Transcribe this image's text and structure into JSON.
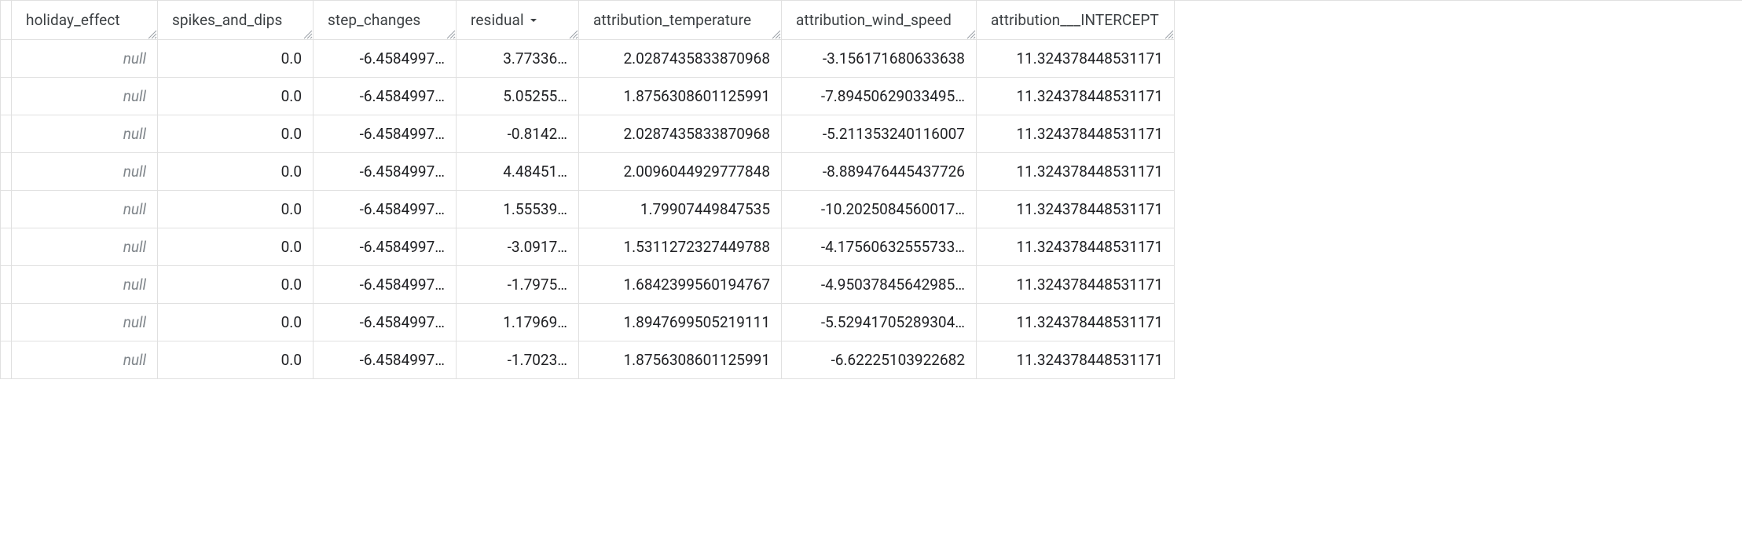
{
  "columns": [
    {
      "id": "holiday_effect",
      "label": "holiday_effect",
      "sorted": false
    },
    {
      "id": "spikes_and_dips",
      "label": "spikes_and_dips",
      "sorted": false
    },
    {
      "id": "step_changes",
      "label": "step_changes",
      "sorted": false
    },
    {
      "id": "residual",
      "label": "residual",
      "sorted": true
    },
    {
      "id": "attribution_temperature",
      "label": "attribution_temperature",
      "sorted": false
    },
    {
      "id": "attribution_wind_speed",
      "label": "attribution_wind_speed",
      "sorted": false
    },
    {
      "id": "attribution_intercept",
      "label": "attribution___INTERCEPT",
      "sorted": false
    }
  ],
  "null_label": "null",
  "rows": [
    {
      "holiday_effect": null,
      "spikes_and_dips": "0.0",
      "step_changes": "-6.4584997…",
      "residual": "3.77336…",
      "attribution_temperature": "2.0287435833870968",
      "attribution_wind_speed": "-3.156171680633638",
      "attribution_intercept": "11.324378448531171"
    },
    {
      "holiday_effect": null,
      "spikes_and_dips": "0.0",
      "step_changes": "-6.4584997…",
      "residual": "5.05255…",
      "attribution_temperature": "1.8756308601125991",
      "attribution_wind_speed": "-7.89450629033495…",
      "attribution_intercept": "11.324378448531171"
    },
    {
      "holiday_effect": null,
      "spikes_and_dips": "0.0",
      "step_changes": "-6.4584997…",
      "residual": "-0.8142…",
      "attribution_temperature": "2.0287435833870968",
      "attribution_wind_speed": "-5.211353240116007",
      "attribution_intercept": "11.324378448531171"
    },
    {
      "holiday_effect": null,
      "spikes_and_dips": "0.0",
      "step_changes": "-6.4584997…",
      "residual": "4.48451…",
      "attribution_temperature": "2.0096044929777848",
      "attribution_wind_speed": "-8.889476445437726",
      "attribution_intercept": "11.324378448531171"
    },
    {
      "holiday_effect": null,
      "spikes_and_dips": "0.0",
      "step_changes": "-6.4584997…",
      "residual": "1.55539…",
      "attribution_temperature": "1.79907449847535",
      "attribution_wind_speed": "-10.2025084560017…",
      "attribution_intercept": "11.324378448531171"
    },
    {
      "holiday_effect": null,
      "spikes_and_dips": "0.0",
      "step_changes": "-6.4584997…",
      "residual": "-3.0917…",
      "attribution_temperature": "1.5311272327449788",
      "attribution_wind_speed": "-4.17560632555733…",
      "attribution_intercept": "11.324378448531171"
    },
    {
      "holiday_effect": null,
      "spikes_and_dips": "0.0",
      "step_changes": "-6.4584997…",
      "residual": "-1.7975…",
      "attribution_temperature": "1.6842399560194767",
      "attribution_wind_speed": "-4.95037845642985…",
      "attribution_intercept": "11.324378448531171"
    },
    {
      "holiday_effect": null,
      "spikes_and_dips": "0.0",
      "step_changes": "-6.4584997…",
      "residual": "1.17969…",
      "attribution_temperature": "1.8947699505219111",
      "attribution_wind_speed": "-5.52941705289304…",
      "attribution_intercept": "11.324378448531171"
    },
    {
      "holiday_effect": null,
      "spikes_and_dips": "0.0",
      "step_changes": "-6.4584997…",
      "residual": "-1.7023…",
      "attribution_temperature": "1.8756308601125991",
      "attribution_wind_speed": "-6.62225103922682",
      "attribution_intercept": "11.324378448531171"
    }
  ]
}
